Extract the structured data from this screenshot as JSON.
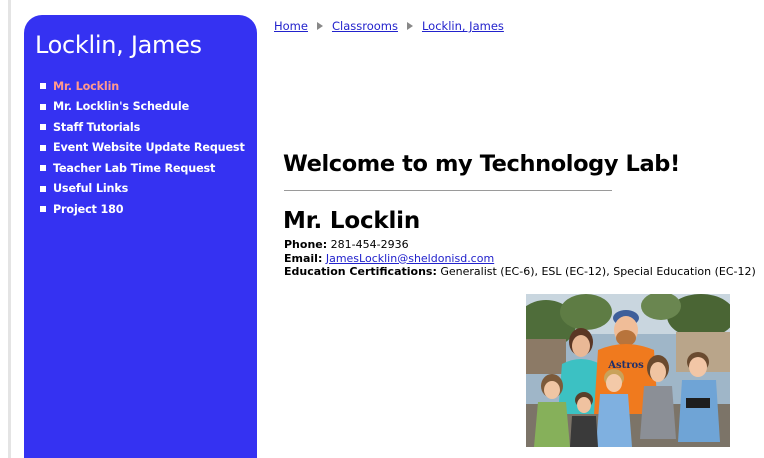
{
  "sidebar": {
    "title": "Locklin, James",
    "items": [
      {
        "label": "Mr. Locklin",
        "active": true
      },
      {
        "label": "Mr. Locklin's Schedule",
        "active": false
      },
      {
        "label": "Staff Tutorials",
        "active": false
      },
      {
        "label": "Event Website Update Request",
        "active": false
      },
      {
        "label": "Teacher Lab Time Request",
        "active": false
      },
      {
        "label": "Useful Links",
        "active": false
      },
      {
        "label": "Project 180",
        "active": false
      }
    ]
  },
  "breadcrumb": [
    "Home",
    "Classrooms",
    "Locklin, James"
  ],
  "main": {
    "welcome": "Welcome to my Technology Lab!",
    "name": "Mr. Locklin",
    "phone_label": "Phone:",
    "phone": "281-454-2936",
    "email_label": "Email:",
    "email": "JamesLocklin@sheldonisd.com",
    "certs_label": "Education Certifications:",
    "certs": "Generalist (EC-6), ESL (EC-12), Special Education (EC-12)",
    "photo_shirt_text": "Astros"
  },
  "colors": {
    "sidebar_bg": "#3532f2",
    "active_nav": "#ff9a8c",
    "link": "#2222cc"
  }
}
